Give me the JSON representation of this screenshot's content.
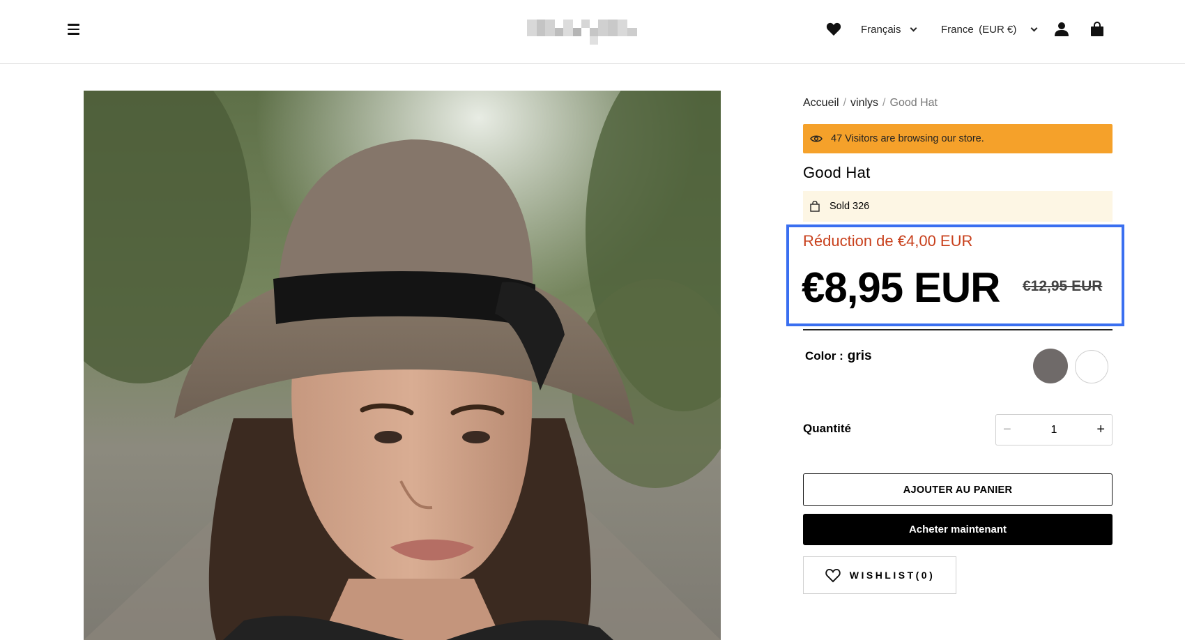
{
  "header": {
    "menu_icon": "hamburger-menu-icon",
    "wishlist_icon": "heart-icon",
    "language": "Français",
    "currency": "France (EUR €)",
    "account_icon": "user-icon",
    "cart_icon": "shopping-bag-icon"
  },
  "breadcrumb": {
    "home": "Accueil",
    "separator": "/",
    "collection": "vinlys",
    "current": "Good Hat"
  },
  "product": {
    "visitors_text": "47 Visitors are browsing our store.",
    "title": "Good Hat",
    "sold_text": "Sold 326",
    "discount_text": "Réduction de €4,00 EUR",
    "price": "€8,95 EUR",
    "compare_price": "€12,95 EUR",
    "color_label": "Color :",
    "color_value": "gris",
    "colors": [
      {
        "name": "gris",
        "hex": "#6f6a69",
        "selected": true
      },
      {
        "name": "blanc",
        "hex": "#ffffff",
        "selected": false
      }
    ],
    "quantity_label": "Quantité",
    "quantity": "1",
    "minus": "−",
    "plus": "+",
    "add_to_cart": "AJOUTER AU PANIER",
    "buy_now": "Acheter maintenant",
    "wishlist": "WISHLIST(0)"
  },
  "colors": {
    "visitors_bg": "#f5a12a",
    "sold_bg": "#fdf6e4",
    "discount": "#c8401c",
    "highlight_border": "#3a6ff0"
  }
}
